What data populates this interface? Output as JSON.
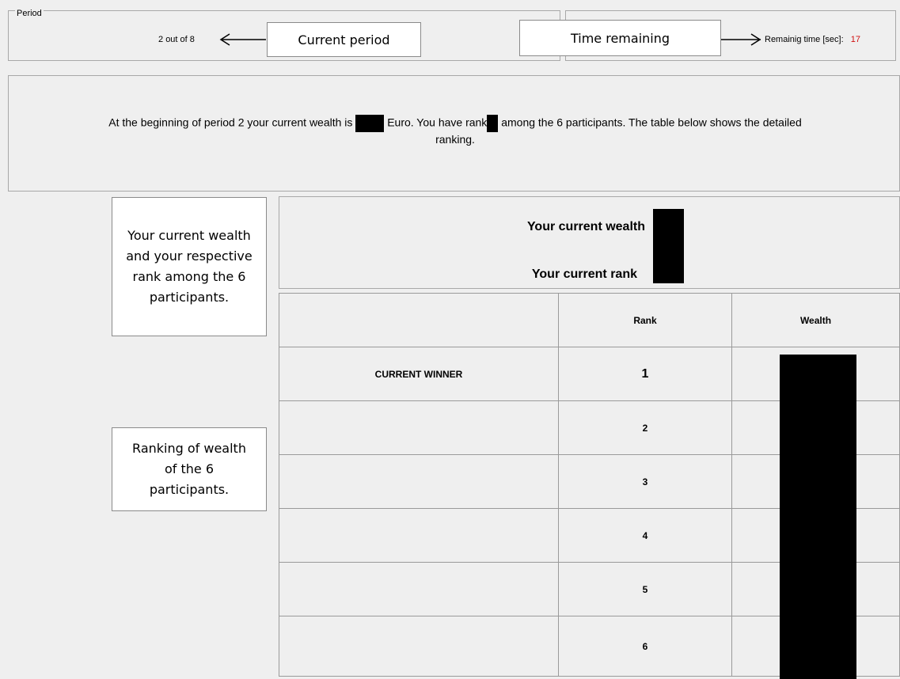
{
  "header": {
    "legend": "Period",
    "period_current": "2",
    "period_out_of": "out of",
    "period_total": "8",
    "callout_period": "Current period",
    "callout_time": "Time remaining",
    "remaining_label": "Remainig time [sec]:",
    "remaining_value": "17",
    "remaining_color": "#d01010"
  },
  "message": {
    "part1": "At the beginning of period 2 your current wealth is",
    "part2": "Euro. You have rank",
    "part3": "among the 6 participants. The table below shows the detailed",
    "part4": "ranking."
  },
  "callouts": {
    "wealth_rank": "Your current wealth and your respective rank among the 6 participants.",
    "ranking": "Ranking of wealth of the 6 participants."
  },
  "summary": {
    "wealth_label": "Your current wealth",
    "rank_label": "Your current rank"
  },
  "table": {
    "headers": [
      "",
      "Rank",
      "Wealth"
    ],
    "rows": [
      {
        "label": "CURRENT WINNER",
        "rank": "1"
      },
      {
        "label": "",
        "rank": "2"
      },
      {
        "label": "",
        "rank": "3"
      },
      {
        "label": "",
        "rank": "4"
      },
      {
        "label": "",
        "rank": "5"
      },
      {
        "label": "",
        "rank": "6"
      }
    ]
  }
}
